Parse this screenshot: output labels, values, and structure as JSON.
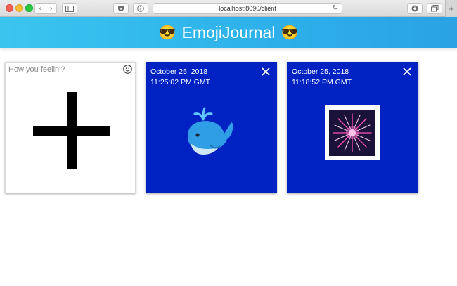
{
  "browser": {
    "url": "localhost:8090/client"
  },
  "header": {
    "title": "EmojiJournal",
    "left_emoji": "😎",
    "right_emoji": "😎"
  },
  "new_entry": {
    "placeholder": "How you feelin'?",
    "icons": {
      "emoji_picker": "smiley-icon",
      "add": "plus-icon"
    }
  },
  "entries": [
    {
      "date": "October 25, 2018",
      "time": "11:25:02 PM GMT",
      "emoji_name": "spouting-whale"
    },
    {
      "date": "October 25, 2018",
      "time": "11:18:52 PM GMT",
      "emoji_name": "fireworks"
    }
  ],
  "colors": {
    "header_start": "#3ac5ef",
    "header_end": "#2aa2e4",
    "entry_card_bg": "#0022c2"
  }
}
